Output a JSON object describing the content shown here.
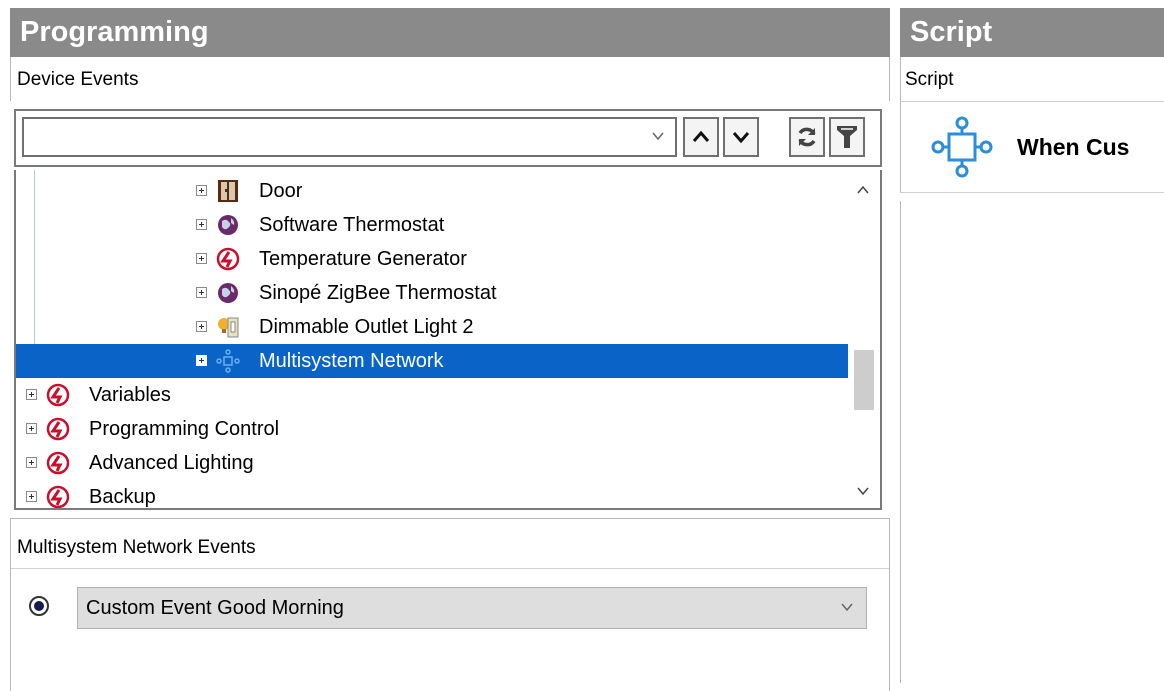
{
  "programming": {
    "title": "Programming",
    "device_events_label": "Device Events",
    "combo_value": "",
    "tree": [
      {
        "label": "Door",
        "icon": "door-icon",
        "depth": 1
      },
      {
        "label": "Software Thermostat",
        "icon": "thermostat-globe-icon",
        "depth": 1
      },
      {
        "label": "Temperature Generator",
        "icon": "red-logo-icon",
        "depth": 1
      },
      {
        "label": "Sinopé ZigBee Thermostat",
        "icon": "thermostat-globe-icon",
        "depth": 1
      },
      {
        "label": "Dimmable Outlet Light 2",
        "icon": "outlet-light-icon",
        "depth": 1
      },
      {
        "label": "Multisystem Network",
        "icon": "network-icon",
        "depth": 1,
        "selected": true
      },
      {
        "label": "Variables",
        "icon": "red-logo-icon",
        "depth": 0
      },
      {
        "label": "Programming Control",
        "icon": "red-logo-icon",
        "depth": 0
      },
      {
        "label": "Advanced Lighting",
        "icon": "red-logo-icon",
        "depth": 0
      },
      {
        "label": "Backup",
        "icon": "red-logo-icon",
        "depth": 0
      }
    ],
    "events_label": "Multisystem Network Events",
    "selected_event": "Custom Event Good Morning"
  },
  "script": {
    "title": "Script",
    "label": "Script",
    "row_text": "When Cus"
  },
  "colors": {
    "header_bg": "#8a8a8a",
    "selection": "#0a64c8",
    "logo_red": "#c8102e",
    "network_blue": "#2a8fd8"
  }
}
